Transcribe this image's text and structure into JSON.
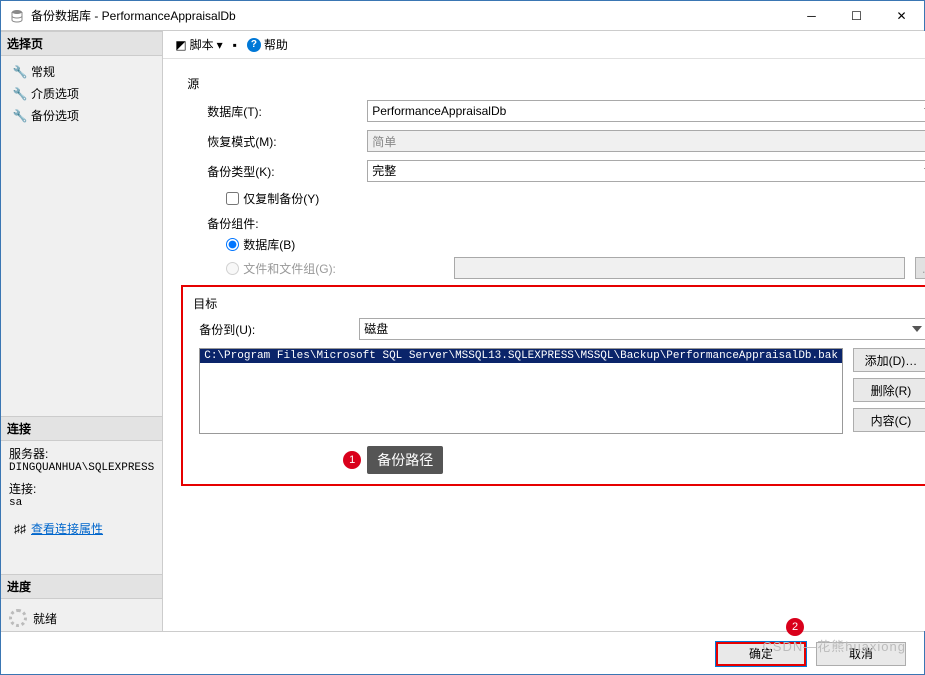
{
  "window": {
    "title": "备份数据库 - PerformanceAppraisalDb"
  },
  "sidebar": {
    "select_page_header": "选择页",
    "pages": [
      {
        "icon": "wrench",
        "label": "常规"
      },
      {
        "icon": "wrench",
        "label": "介质选项"
      },
      {
        "icon": "wrench",
        "label": "备份选项"
      }
    ],
    "connection_header": "连接",
    "server_label": "服务器:",
    "server_value": "DINGQUANHUA\\SQLEXPRESS",
    "conn_label": "连接:",
    "conn_value": "sa",
    "view_props": "查看连接属性",
    "progress_header": "进度",
    "progress_status": "就绪"
  },
  "toolbar": {
    "script": "脚本",
    "help": "帮助"
  },
  "source": {
    "legend": "源",
    "database_label": "数据库(T):",
    "database_value": "PerformanceAppraisalDb",
    "recovery_label": "恢复模式(M):",
    "recovery_value": "简单",
    "type_label": "备份类型(K):",
    "type_value": "完整",
    "copyonly_label": "仅复制备份(Y)",
    "component_label": "备份组件:",
    "radio_db": "数据库(B)",
    "radio_files": "文件和文件组(G):"
  },
  "dest": {
    "legend": "目标",
    "backup_to_label": "备份到(U):",
    "backup_to_value": "磁盘",
    "path": "C:\\Program Files\\Microsoft SQL Server\\MSSQL13.SQLEXPRESS\\MSSQL\\Backup\\PerformanceAppraisalDb.bak",
    "add_btn": "添加(D)…",
    "remove_btn": "删除(R)",
    "contents_btn": "内容(C)"
  },
  "annotations": {
    "n1": "1",
    "t1": "备份路径",
    "n2": "2"
  },
  "footer": {
    "ok": "确定",
    "cancel": "取消"
  },
  "watermark": "CSDN—花熊huaxiong"
}
